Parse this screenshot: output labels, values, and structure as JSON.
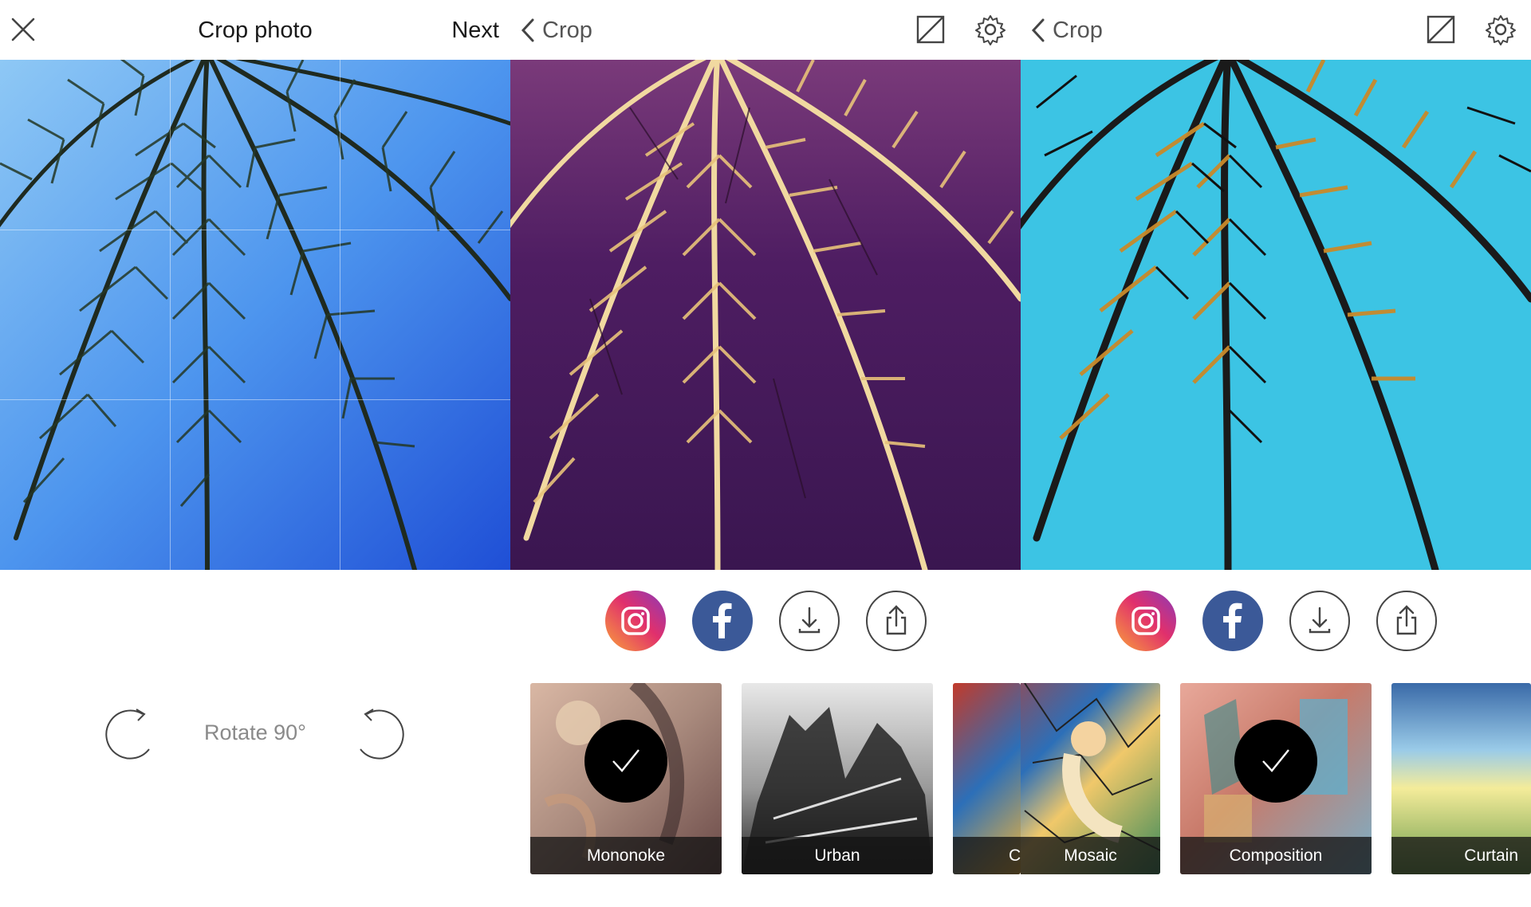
{
  "panel1": {
    "title": "Crop photo",
    "next_label": "Next",
    "rotate_label": "Rotate 90°"
  },
  "panel2": {
    "back_label": "Crop",
    "filters": [
      {
        "label": "Mononoke",
        "selected": true
      },
      {
        "label": "Urban",
        "selected": false
      },
      {
        "label": "C"
      }
    ]
  },
  "panel3": {
    "back_label": "Crop",
    "filters": [
      {
        "label": "Mosaic",
        "selected": false
      },
      {
        "label": "Composition",
        "selected": true
      },
      {
        "label": "Curtain",
        "selected": false
      }
    ]
  },
  "share_buttons": [
    "instagram-icon",
    "facebook-icon",
    "download-icon",
    "share-icon"
  ],
  "colors": {
    "instagram_start": "#f58529",
    "instagram_mid": "#dd2a7b",
    "instagram_end": "#8134af",
    "facebook": "#3b5998",
    "sky_original": "#3a7de8",
    "sky_mononoke": "#4a1a5c",
    "sky_composition": "#34c6e6"
  }
}
